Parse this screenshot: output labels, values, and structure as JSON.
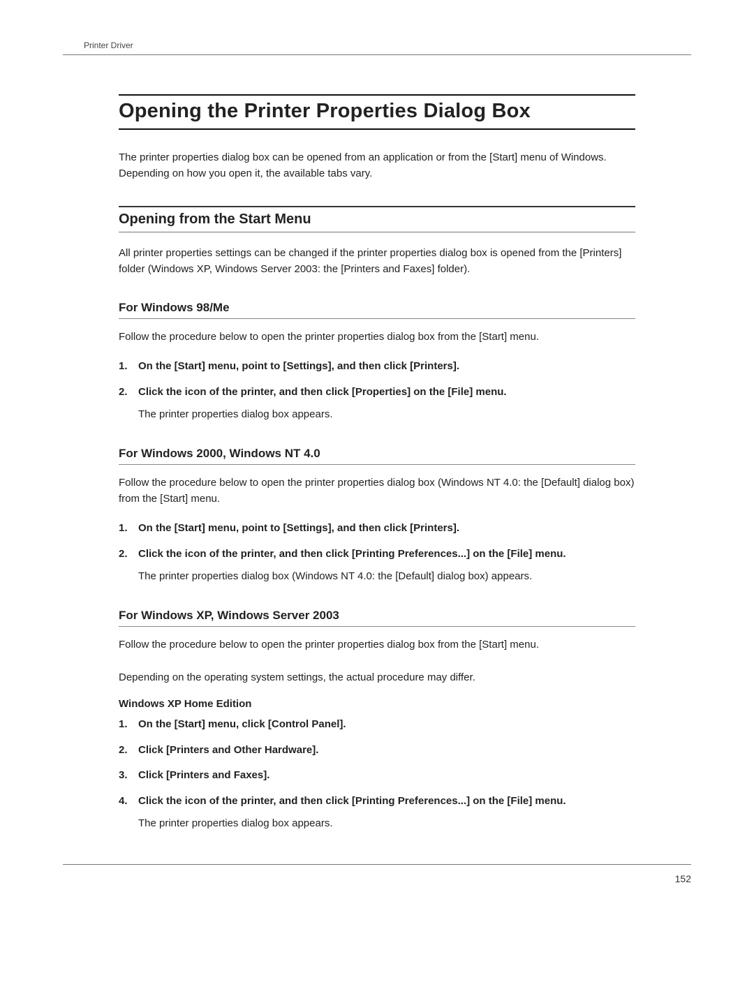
{
  "running_head": "Printer Driver",
  "title": "Opening the Printer Properties Dialog Box",
  "intro": "The printer properties dialog box can be opened from an application or from the [Start] menu of Windows. Depending on how you open it, the available tabs vary.",
  "section1": {
    "heading": "Opening from the Start Menu",
    "body": "All printer properties settings can be changed if the printer properties dialog box is opened from the [Printers] folder (Windows XP, Windows Server 2003: the [Printers and Faxes] folder)."
  },
  "sub1": {
    "heading": "For Windows 98/Me",
    "body": "Follow the procedure below to open the printer properties dialog box from the [Start] menu.",
    "steps": [
      {
        "n": "1.",
        "text": "On the [Start] menu, point to [Settings], and then click [Printers]."
      },
      {
        "n": "2.",
        "text": "Click the icon of the printer, and then click [Properties] on the [File] menu.",
        "note": "The printer properties dialog box appears."
      }
    ]
  },
  "sub2": {
    "heading": "For Windows 2000, Windows NT 4.0",
    "body": "Follow the procedure below to open the printer properties dialog box (Windows NT 4.0: the [Default] dialog box) from the [Start] menu.",
    "steps": [
      {
        "n": "1.",
        "text": "On the [Start] menu, point to [Settings], and then click [Printers]."
      },
      {
        "n": "2.",
        "text": "Click the icon of the printer, and then click [Printing Preferences...] on the [File] menu.",
        "note": "The printer properties dialog box (Windows NT 4.0: the [Default] dialog box) appears."
      }
    ]
  },
  "sub3": {
    "heading": "For Windows XP, Windows Server 2003",
    "body1": "Follow the procedure below to open the printer properties dialog box from the [Start] menu.",
    "body2": "Depending on the operating system settings, the actual procedure may differ.",
    "subhead": "Windows XP Home Edition",
    "steps": [
      {
        "n": "1.",
        "text": "On the [Start] menu, click [Control Panel]."
      },
      {
        "n": "2.",
        "text": "Click [Printers and Other Hardware]."
      },
      {
        "n": "3.",
        "text": "Click [Printers and Faxes]."
      },
      {
        "n": "4.",
        "text": "Click the icon of the printer, and then click [Printing Preferences...] on the [File] menu.",
        "note": "The printer properties dialog box appears."
      }
    ]
  },
  "page_number": "152"
}
